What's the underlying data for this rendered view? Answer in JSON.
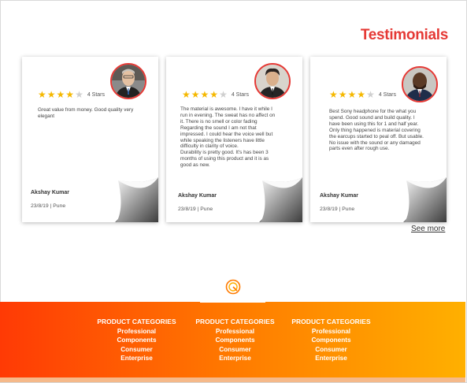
{
  "header": {
    "title": "Testimonials"
  },
  "testimonials": [
    {
      "rating": 4,
      "stars_label": "4 Stars",
      "review": "Great value from money. Good quality very elegant",
      "author": "Akshay Kumar",
      "date_location": "23/8/19 | Pune"
    },
    {
      "rating": 4,
      "stars_label": "4 Stars",
      "review": "The material is awesome. I have it while I run in evening. The sweat has no affect on it. There is no smell or color fading\nRegarding the sound I am not that impressed. I could hear the voice well but while speaking the listeners have little difficulty in clarity of voice.\nDurability is pretty good. It's has been 3 months of using this product and it is as good as new.",
      "author": "Akshay Kumar",
      "date_location": "23/8/19 | Pune"
    },
    {
      "rating": 4,
      "stars_label": "4 Stars",
      "review": "Best Sony headphone for the what you spend. Good sound and build quality. I have been using this for 1 and half year. Only thing happened is material covering the earcups started to peal off. But usable. No issue with the sound or any damaged parts even after rough use.",
      "author": "Akshay Kumar",
      "date_location": "23/8/19 | Pune"
    }
  ],
  "see_more": "See more",
  "footer": {
    "columns": [
      {
        "heading": "PRODUCT CATEGORIES",
        "items": [
          "Professional",
          "Components",
          "Consumer",
          "Enterprise"
        ]
      },
      {
        "heading": "PRODUCT CATEGORIES",
        "items": [
          "Professional",
          "Components",
          "Consumer",
          "Enterprise"
        ]
      },
      {
        "heading": "PRODUCT CATEGORIES",
        "items": [
          "Professional",
          "Components",
          "Consumer",
          "Enterprise"
        ]
      }
    ]
  },
  "colors": {
    "accent": "#e53935",
    "star": "#f5b800",
    "footer_start": "#ff3a05",
    "footer_end": "#ffb000"
  }
}
